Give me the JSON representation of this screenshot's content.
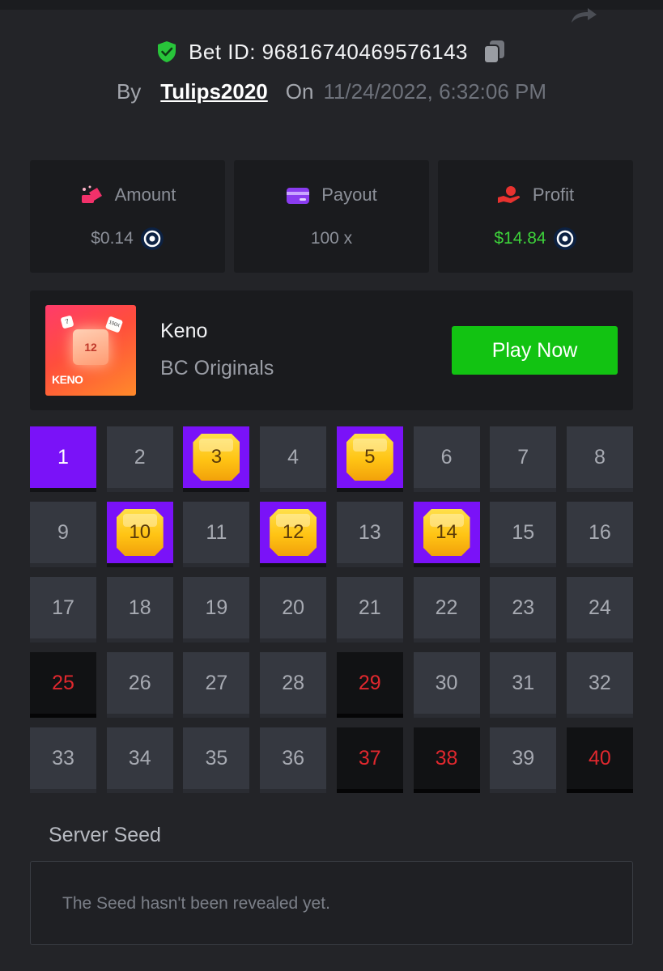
{
  "header": {
    "bet_id_label": "Bet ID: 96816740469576143",
    "by_label": "By",
    "username": "Tulips2020",
    "on_label": "On",
    "date": "11/24/2022, 6:32:06 PM"
  },
  "stats": {
    "amount": {
      "label": "Amount",
      "value": "$0.14"
    },
    "payout": {
      "label": "Payout",
      "value": "100 x"
    },
    "profit": {
      "label": "Profit",
      "value": "$14.84"
    }
  },
  "game": {
    "name": "Keno",
    "provider": "BC Originals",
    "play_label": "Play Now",
    "thumb_title": "KENO",
    "thumb_number": "12",
    "thumb_die1": "7",
    "thumb_die2": "100X"
  },
  "board": {
    "tiles": [
      {
        "n": "1",
        "state": "picked"
      },
      {
        "n": "2",
        "state": "normal"
      },
      {
        "n": "3",
        "state": "hit"
      },
      {
        "n": "4",
        "state": "normal"
      },
      {
        "n": "5",
        "state": "hit"
      },
      {
        "n": "6",
        "state": "normal"
      },
      {
        "n": "7",
        "state": "normal"
      },
      {
        "n": "8",
        "state": "normal"
      },
      {
        "n": "9",
        "state": "normal"
      },
      {
        "n": "10",
        "state": "hit"
      },
      {
        "n": "11",
        "state": "normal"
      },
      {
        "n": "12",
        "state": "hit"
      },
      {
        "n": "13",
        "state": "normal"
      },
      {
        "n": "14",
        "state": "hit"
      },
      {
        "n": "15",
        "state": "normal"
      },
      {
        "n": "16",
        "state": "normal"
      },
      {
        "n": "17",
        "state": "normal"
      },
      {
        "n": "18",
        "state": "normal"
      },
      {
        "n": "19",
        "state": "normal"
      },
      {
        "n": "20",
        "state": "normal"
      },
      {
        "n": "21",
        "state": "normal"
      },
      {
        "n": "22",
        "state": "normal"
      },
      {
        "n": "23",
        "state": "normal"
      },
      {
        "n": "24",
        "state": "normal"
      },
      {
        "n": "25",
        "state": "miss"
      },
      {
        "n": "26",
        "state": "normal"
      },
      {
        "n": "27",
        "state": "normal"
      },
      {
        "n": "28",
        "state": "normal"
      },
      {
        "n": "29",
        "state": "miss"
      },
      {
        "n": "30",
        "state": "normal"
      },
      {
        "n": "31",
        "state": "normal"
      },
      {
        "n": "32",
        "state": "normal"
      },
      {
        "n": "33",
        "state": "normal"
      },
      {
        "n": "34",
        "state": "normal"
      },
      {
        "n": "35",
        "state": "normal"
      },
      {
        "n": "36",
        "state": "normal"
      },
      {
        "n": "37",
        "state": "miss"
      },
      {
        "n": "38",
        "state": "miss"
      },
      {
        "n": "39",
        "state": "normal"
      },
      {
        "n": "40",
        "state": "miss"
      }
    ]
  },
  "seed": {
    "label": "Server Seed",
    "text": "The Seed hasn't been revealed yet."
  },
  "colors": {
    "background": "#232428",
    "card": "#1a1b1e",
    "tile": "#353840",
    "picked": "#7a12f8",
    "miss_text": "#e0282e",
    "play_button": "#12c312",
    "profit": "#3dd13a"
  },
  "icons": {
    "share": "share-icon",
    "shield": "verified-shield-icon",
    "copy": "copy-icon",
    "amount": "bet-amount-icon",
    "payout": "wallet-card-icon",
    "profit": "hand-coin-icon",
    "coin": "crypto-coin-icon",
    "gem": "gem-icon"
  }
}
